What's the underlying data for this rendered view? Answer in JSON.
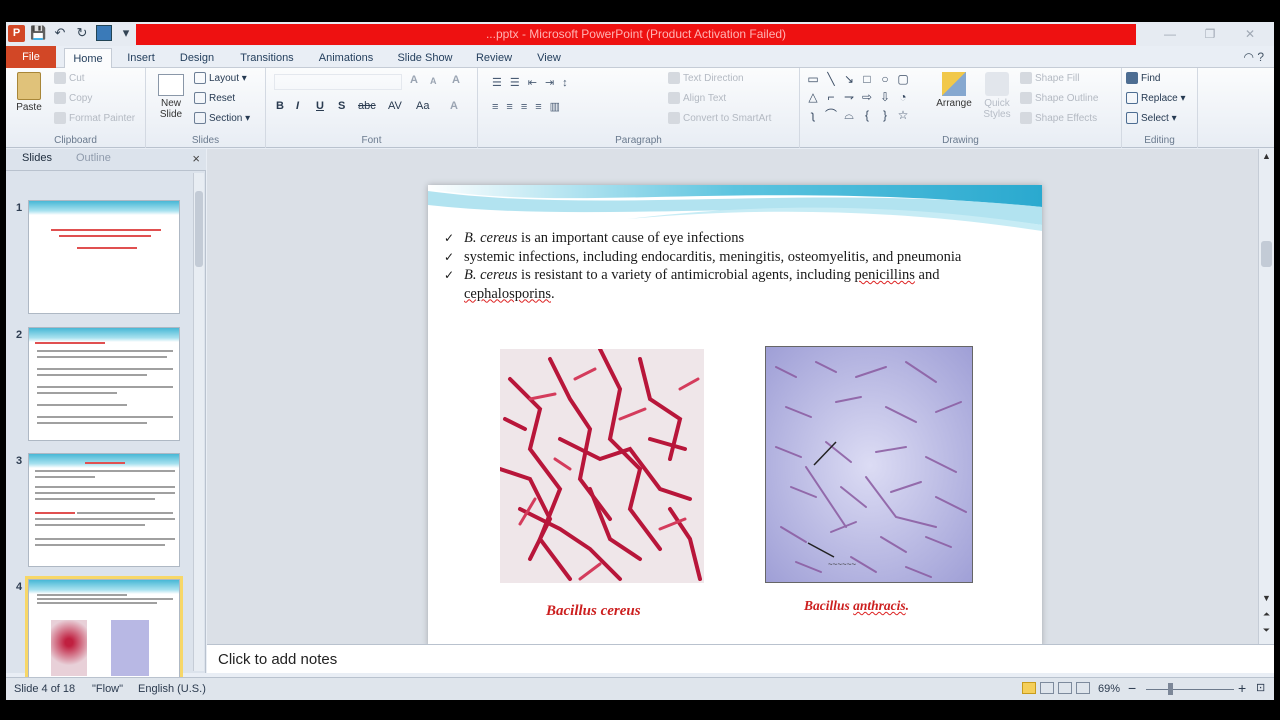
{
  "window": {
    "title": "...pptx - Microsoft PowerPoint (Product Activation Failed)",
    "app_icon_letter": "P",
    "controls": [
      "—",
      "❐",
      "✕"
    ]
  },
  "qat": [
    "save-icon",
    "undo-icon",
    "redo-icon",
    "present-icon",
    "customize-icon"
  ],
  "tabs": [
    {
      "label": "File"
    },
    {
      "label": "Home"
    },
    {
      "label": "Insert"
    },
    {
      "label": "Design"
    },
    {
      "label": "Transitions"
    },
    {
      "label": "Animations"
    },
    {
      "label": "Slide Show"
    },
    {
      "label": "Review"
    },
    {
      "label": "View"
    }
  ],
  "ribbon": {
    "clipboard": {
      "group": "Clipboard",
      "paste": "Paste",
      "cut": "Cut",
      "copy": "Copy",
      "format_painter": "Format Painter"
    },
    "slides": {
      "group": "Slides",
      "new_slide": "New Slide",
      "layout": "Layout",
      "reset": "Reset",
      "section": "Section"
    },
    "font": {
      "group": "Font",
      "bold": "B",
      "italic": "I",
      "underline": "U",
      "shadow": "S",
      "strike": "abc",
      "spacing": "AV",
      "case": "Aa",
      "grow": "A",
      "shrink": "A",
      "clear": "A",
      "color": "A"
    },
    "paragraph": {
      "group": "Paragraph",
      "text_direction": "Text Direction",
      "align_text": "Align Text",
      "convert_smartart": "Convert to SmartArt"
    },
    "drawing": {
      "group": "Drawing",
      "arrange": "Arrange",
      "quick_styles": "Quick Styles",
      "shape_fill": "Shape Fill",
      "shape_outline": "Shape Outline",
      "shape_effects": "Shape Effects"
    },
    "editing": {
      "group": "Editing",
      "find": "Find",
      "replace": "Replace",
      "select": "Select"
    }
  },
  "left_pane": {
    "tab_slides": "Slides",
    "tab_outline": "Outline",
    "close": "×",
    "thumbnails": [
      {
        "num": "1"
      },
      {
        "num": "2"
      },
      {
        "num": "3"
      },
      {
        "num": "4"
      }
    ]
  },
  "slide": {
    "bullet_mark": "✓",
    "b1_italic": "B. cereus",
    "b1_rest": " is an important cause of eye infections",
    "b2": "systemic infections, including endocarditis, meningitis, osteomyelitis, and pneumonia",
    "b3_italic": "B. cereus",
    "b3_rest1": " is resistant to a variety of antimicrobial agents, including ",
    "b3_penicillins": "penicillins",
    "b3_rest2": " and",
    "b3_cephalo": "cephalosporins",
    "b3_end": ".",
    "caption_left": "Bacillus cereus",
    "caption_right_a": "Bacillus ",
    "caption_right_b": "anthracis",
    "caption_right_c": "."
  },
  "notes": {
    "placeholder": "Click to add notes"
  },
  "status": {
    "slide_info": "Slide 4 of 18",
    "theme": "\"Flow\"",
    "language": "English (U.S.)",
    "zoom": "69%",
    "zoom_minus": "−",
    "zoom_plus": "+"
  },
  "colors": {
    "accent": "#d24726",
    "title_bar_red": "#ee1111",
    "caption_red": "#cc1f1f"
  }
}
